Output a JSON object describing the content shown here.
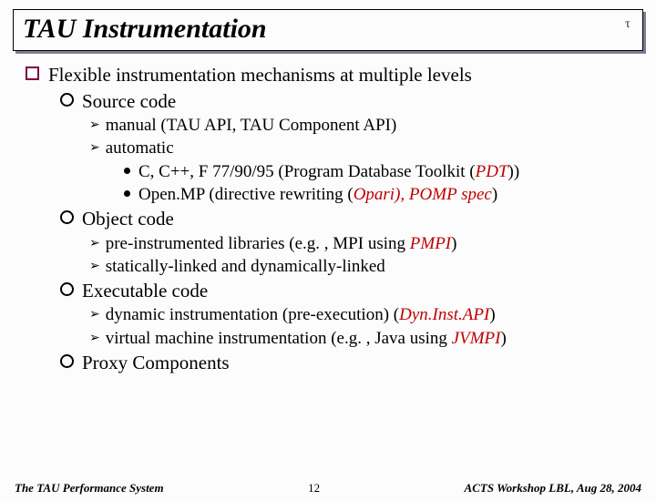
{
  "title": "TAU Instrumentation",
  "logo_symbol": "τ",
  "main_bullet": "Flexible instrumentation mechanisms at multiple levels",
  "sections": {
    "source": {
      "heading": "Source code",
      "manual_pre": "manual ",
      "manual_rest": "(TAU API, TAU Component API)",
      "automatic": "automatic",
      "auto1_pre": "C, C++, F 77/90/95 (Program Database Toolkit (",
      "auto1_em": "PDT",
      "auto1_post": "))",
      "auto2_pre": "Open.MP (directive rewriting (",
      "auto2_em": "Opari), POMP spec",
      "auto2_post": ")"
    },
    "object": {
      "heading": "Object code",
      "pre1_pre": "pre-instrumented ",
      "pre1_mid": "libraries (e.g. , MPI using ",
      "pre1_em": "PMPI",
      "pre1_post": ")",
      "pre2": "statically-linked ",
      "pre2_rest": "and dynamically-linked"
    },
    "exec": {
      "heading": "Executable code",
      "dyn_pre": "dynamic ",
      "dyn_mid": "instrumentation (pre-execution) (",
      "dyn_em": "Dyn.Inst.API",
      "dyn_post": ")",
      "vm_pre": "virtual ",
      "vm_mid": "machine instrumentation (e.g. , Java using ",
      "vm_em": "JVMPI",
      "vm_post": ")"
    },
    "proxy": "Proxy Components"
  },
  "footer": {
    "left": "The TAU Performance System",
    "center": "12",
    "right": "ACTS Workshop LBL, Aug 28, 2004"
  }
}
